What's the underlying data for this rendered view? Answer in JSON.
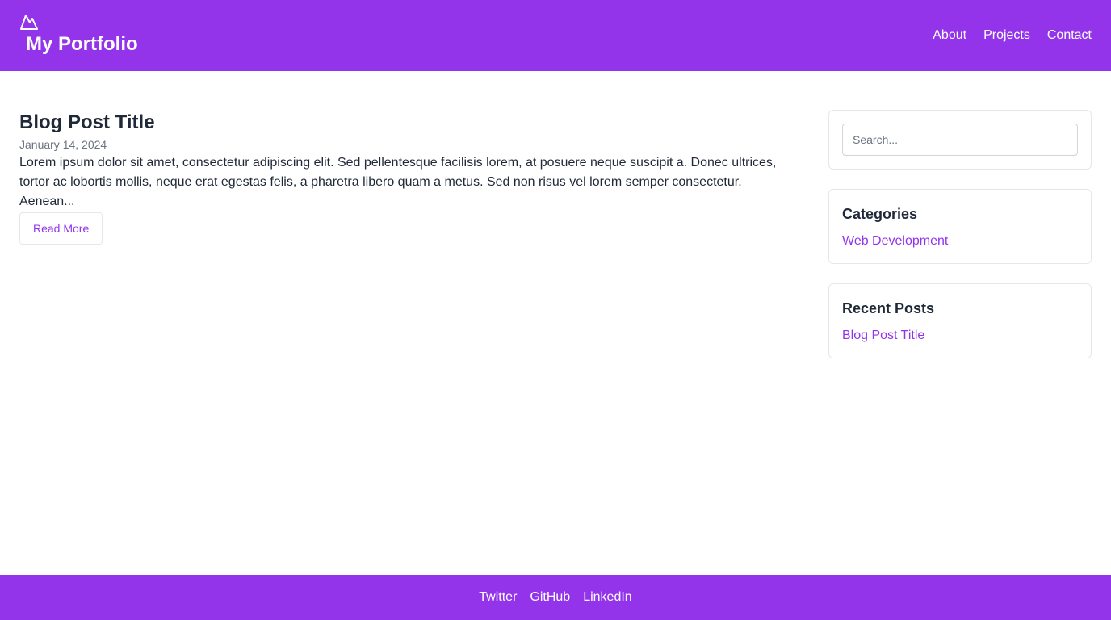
{
  "header": {
    "logo_icon": "mountain-icon",
    "site_title": "My Portfolio",
    "nav": [
      {
        "label": "About"
      },
      {
        "label": "Projects"
      },
      {
        "label": "Contact"
      }
    ]
  },
  "post": {
    "title": "Blog Post Title",
    "date": "January 14, 2024",
    "excerpt": "Lorem ipsum dolor sit amet, consectetur adipiscing elit. Sed pellentesque facilisis lorem, at posuere neque suscipit a. Donec ultrices, tortor ac lobortis mollis, neque erat egestas felis, a pharetra libero quam a metus. Sed non risus vel lorem semper consectetur. Aenean...",
    "read_more_label": "Read More"
  },
  "sidebar": {
    "search": {
      "placeholder": "Search...",
      "value": ""
    },
    "categories": {
      "heading": "Categories",
      "items": [
        {
          "label": "Web Development"
        }
      ]
    },
    "recent_posts": {
      "heading": "Recent Posts",
      "items": [
        {
          "label": "Blog Post Title"
        }
      ]
    }
  },
  "footer": {
    "links": [
      {
        "label": "Twitter"
      },
      {
        "label": "GitHub"
      },
      {
        "label": "LinkedIn"
      }
    ]
  },
  "colors": {
    "brand": "#9333ea",
    "text": "#1f2937",
    "muted": "#6b7280",
    "border": "#e5e7eb"
  }
}
